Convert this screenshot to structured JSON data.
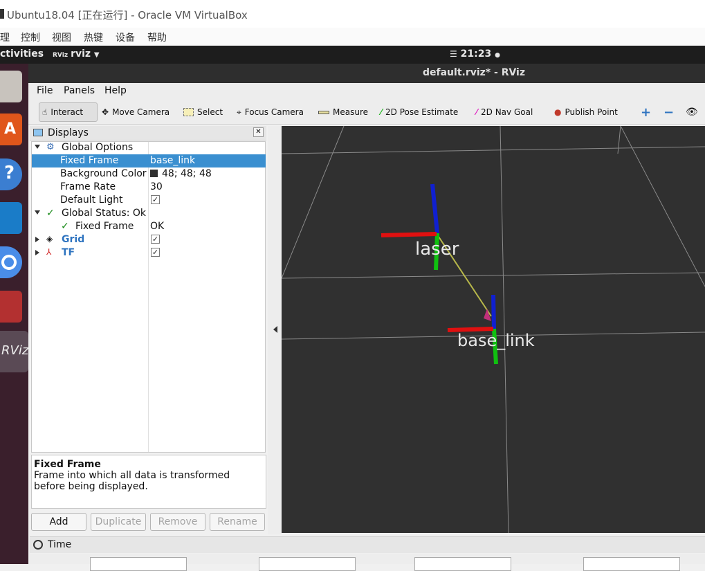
{
  "host": {
    "window_title": "Ubuntu18.04 [正在运行] - Oracle VM VirtualBox",
    "menus": [
      "理",
      "控制",
      "视图",
      "热键",
      "设备",
      "帮助"
    ]
  },
  "gnome": {
    "activities": "ctivities",
    "app_name": "rviz",
    "clock": "21:23"
  },
  "rviz": {
    "window_title": "default.rviz* - RViz",
    "menus": {
      "file": "File",
      "panels": "Panels",
      "help": "Help"
    },
    "toolbar": [
      {
        "label": "Interact",
        "icon": "hand-icon"
      },
      {
        "label": "Move Camera",
        "icon": "move-camera-icon"
      },
      {
        "label": "Select",
        "icon": "select-box-icon"
      },
      {
        "label": "Focus Camera",
        "icon": "focus-camera-icon"
      },
      {
        "label": "Measure",
        "icon": "ruler-icon"
      },
      {
        "label": "2D Pose Estimate",
        "icon": "green-arrow-icon"
      },
      {
        "label": "2D Nav Goal",
        "icon": "pink-arrow-icon"
      },
      {
        "label": "Publish Point",
        "icon": "pin-icon"
      }
    ]
  },
  "displays": {
    "title": "Displays",
    "tree": {
      "global_options": "Global Options",
      "fixed_frame_label": "Fixed Frame",
      "fixed_frame_value": "base_link",
      "bg_color_label": "Background Color",
      "bg_color_value": "48; 48; 48",
      "frame_rate_label": "Frame Rate",
      "frame_rate_value": "30",
      "default_light_label": "Default Light",
      "global_status": "Global Status: Ok",
      "status_fixed_frame_label": "Fixed Frame",
      "status_fixed_frame_value": "OK",
      "grid": "Grid",
      "tf": "TF"
    },
    "description": {
      "title": "Fixed Frame",
      "text": "Frame into which all data is transformed before being displayed."
    },
    "buttons": {
      "add": "Add",
      "duplicate": "Duplicate",
      "remove": "Remove",
      "rename": "Rename"
    }
  },
  "viewport": {
    "frames": [
      {
        "name": "laser"
      },
      {
        "name": "base_link"
      }
    ],
    "background": "#303030"
  },
  "time": {
    "title": "Time"
  },
  "colors": {
    "selection": "#3a8fd0",
    "axis_x": "#e01010",
    "axis_y": "#10c010",
    "axis_z": "#1020d0",
    "link": "#b8b84a"
  }
}
